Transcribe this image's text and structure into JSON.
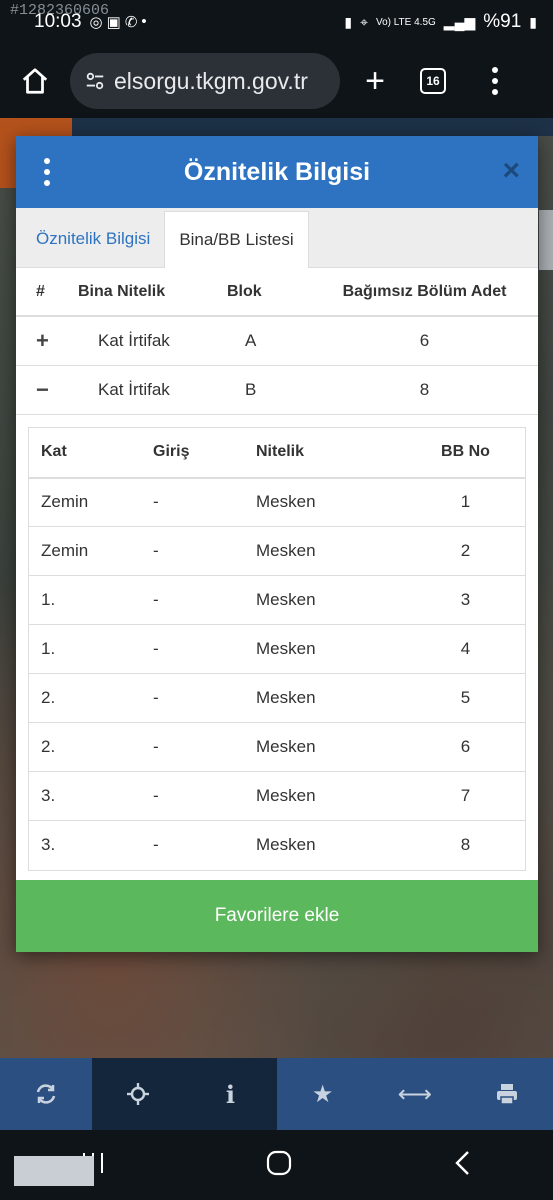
{
  "status_bar": {
    "watermark": "#1282360606",
    "time": "10:03",
    "network": "Vo) LTE 4.5G",
    "battery": "%91"
  },
  "browser": {
    "url": "elsorgu.tkgm.gov.tr",
    "tab_count": "16"
  },
  "modal": {
    "title": "Öznitelik Bilgisi",
    "close": "×",
    "tabs": [
      {
        "label": "Öznitelik Bilgisi",
        "active": false
      },
      {
        "label": "Bina/BB Listesi",
        "active": true
      }
    ],
    "bina_table": {
      "headers": [
        "#",
        "Bina Nitelik",
        "Blok",
        "Bağımsız Bölüm Adet"
      ],
      "rows": [
        {
          "sign": "+",
          "nitelik": "Kat İrtifak",
          "blok": "A",
          "adet": "6"
        },
        {
          "sign": "−",
          "nitelik": "Kat İrtifak",
          "blok": "B",
          "adet": "8"
        }
      ]
    },
    "bb_table": {
      "headers": [
        "Kat",
        "Giriş",
        "Nitelik",
        "BB No"
      ],
      "rows": [
        [
          "Zemin",
          "-",
          "Mesken",
          "1"
        ],
        [
          "Zemin",
          "-",
          "Mesken",
          "2"
        ],
        [
          "1.",
          "-",
          "Mesken",
          "3"
        ],
        [
          "1.",
          "-",
          "Mesken",
          "4"
        ],
        [
          "2.",
          "-",
          "Mesken",
          "5"
        ],
        [
          "2.",
          "-",
          "Mesken",
          "6"
        ],
        [
          "3.",
          "-",
          "Mesken",
          "7"
        ],
        [
          "3.",
          "-",
          "Mesken",
          "8"
        ]
      ]
    },
    "favorite_button": "Favorilere ekle"
  },
  "toolbar": {
    "items": [
      "refresh-icon",
      "crosshair-icon",
      "info-icon",
      "star-icon",
      "arrows-horizontal-icon",
      "print-icon"
    ],
    "active_index": 1
  }
}
